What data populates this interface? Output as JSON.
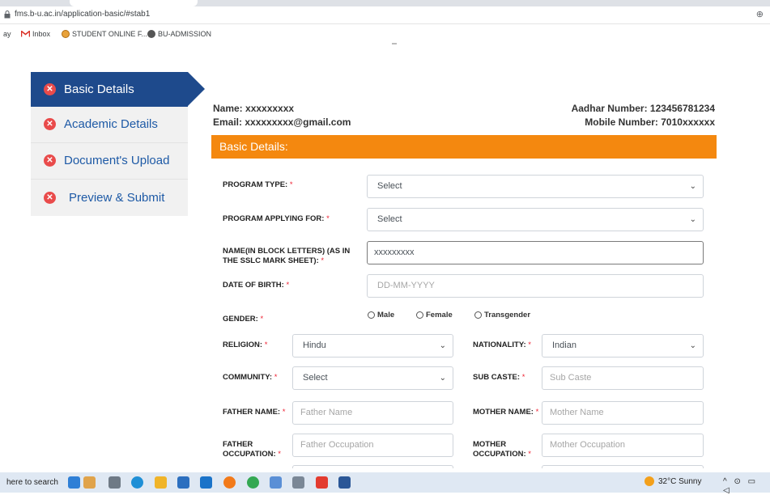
{
  "browser": {
    "url": "fms.b-u.ac.in/application-basic/#stab1",
    "bookmarks": [
      {
        "label": "ay"
      },
      {
        "label": "Inbox"
      },
      {
        "label": "STUDENT ONLINE F..."
      },
      {
        "label": "BU-ADMISSION"
      }
    ]
  },
  "sidebar": {
    "items": [
      {
        "label": "Basic Details",
        "active": true
      },
      {
        "label": "Academic Details"
      },
      {
        "label": "Document's Upload"
      },
      {
        "label": "Preview & Submit"
      }
    ],
    "status_glyph": "✕"
  },
  "applicant": {
    "name": "Name: xxxxxxxxx",
    "email": "Email: xxxxxxxxx@gmail.com",
    "aadhar": "Aadhar Number: 123456781234",
    "mobile": "Mobile Number: 7010xxxxxx"
  },
  "section_title": "Basic Details:",
  "required_mark": "*",
  "form": {
    "program_type": {
      "label": "PROGRAM TYPE:",
      "value": "Select"
    },
    "program_applying": {
      "label": "PROGRAM APPLYING FOR:",
      "value": "Select"
    },
    "name": {
      "label_1": "NAME(IN BLOCK LETTERS) (AS IN",
      "label_2": "THE SSLC MARK SHEET):",
      "value": "xxxxxxxxx"
    },
    "dob": {
      "label": "DATE OF BIRTH:",
      "placeholder": "DD-MM-YYYY"
    },
    "gender": {
      "label": "GENDER:",
      "options": [
        "Male",
        "Female",
        "Transgender"
      ]
    },
    "religion": {
      "label": "RELIGION:",
      "value": "Hindu"
    },
    "nationality": {
      "label": "NATIONALITY:",
      "value": "Indian"
    },
    "community": {
      "label": "COMMUNITY:",
      "value": "Select"
    },
    "sub_caste": {
      "label": "SUB CASTE:",
      "placeholder": "Sub Caste"
    },
    "father_name": {
      "label": "FATHER NAME:",
      "placeholder": "Father Name"
    },
    "mother_name": {
      "label": "MOTHER NAME:",
      "placeholder": "Mother Name"
    },
    "father_occupation": {
      "label_1": "FATHER",
      "label_2": "OCCUPATION:",
      "placeholder": "Father Occupation"
    },
    "mother_occupation": {
      "label_1": "MOTHER",
      "label_2": "OCCUPATION:",
      "placeholder": "Mother Occupation"
    }
  },
  "taskbar": {
    "search_text": "here to search",
    "weather": "32°C Sunny"
  },
  "colors": {
    "active_nav": "#1e4a8c",
    "section_bar": "#f4880f",
    "status_icon": "#e94b4b"
  }
}
